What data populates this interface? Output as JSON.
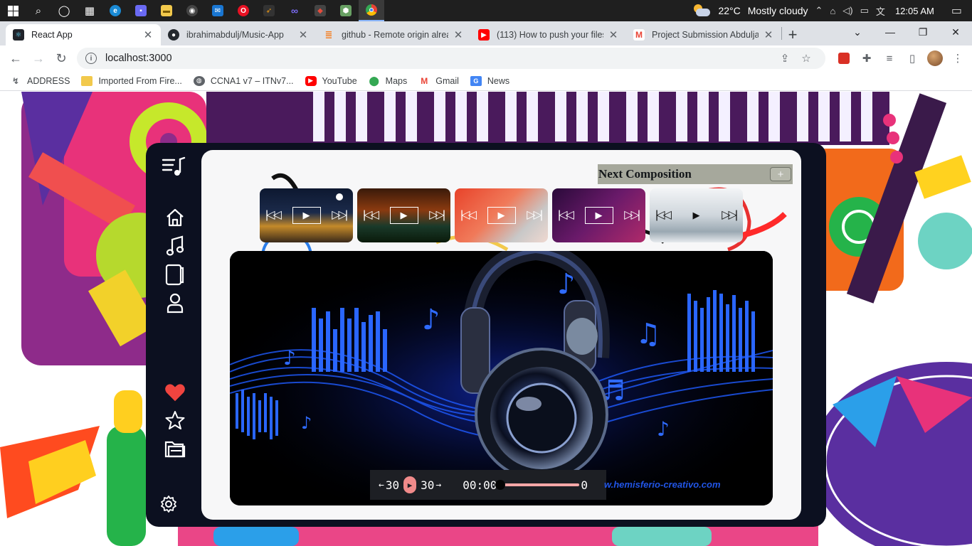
{
  "taskbar": {
    "weather_temp": "22°C",
    "weather_text": "Mostly cloudy",
    "clock": "12:05 AM"
  },
  "browser": {
    "tabs": [
      {
        "title": "React App",
        "favicon": "react-icon",
        "color": "#61dafb"
      },
      {
        "title": "ibrahimabdulj/Music-App",
        "favicon": "github-icon",
        "color": "#24292e"
      },
      {
        "title": "github - Remote origin alread",
        "favicon": "stackoverflow-icon",
        "color": "#f48024"
      },
      {
        "title": "(113) How to push your files",
        "favicon": "youtube-icon",
        "color": "#ff0000"
      },
      {
        "title": "Project Submission Abduljab",
        "favicon": "gmail-icon",
        "color": "#ea4335"
      }
    ],
    "url": "localhost:3000",
    "bookmarks": [
      {
        "label": "ADDRESS",
        "icon": "link-icon",
        "color": "#5f6368"
      },
      {
        "label": "Imported From Fire...",
        "icon": "folder-icon",
        "color": "#f2c94c"
      },
      {
        "label": "CCNA1 v7 – ITNv7...",
        "icon": "globe-icon",
        "color": "#5f6368"
      },
      {
        "label": "YouTube",
        "icon": "youtube-icon",
        "color": "#ff0000"
      },
      {
        "label": "Maps",
        "icon": "maps-icon",
        "color": "#34a853"
      },
      {
        "label": "Gmail",
        "icon": "gmail-icon",
        "color": "#ea4335"
      },
      {
        "label": "News",
        "icon": "news-icon",
        "color": "#4285f4"
      }
    ]
  },
  "app": {
    "next_title": "Next Composition",
    "add_label": "+",
    "controls": {
      "back_label": "30",
      "forward_label": "30",
      "current_time": "00:00",
      "duration": "0"
    },
    "watermark": "w.hemisferio-creativo.com"
  },
  "colors": {
    "frame": "#0c1020",
    "heart": "#f0443f",
    "accent": "#f08a8a"
  }
}
